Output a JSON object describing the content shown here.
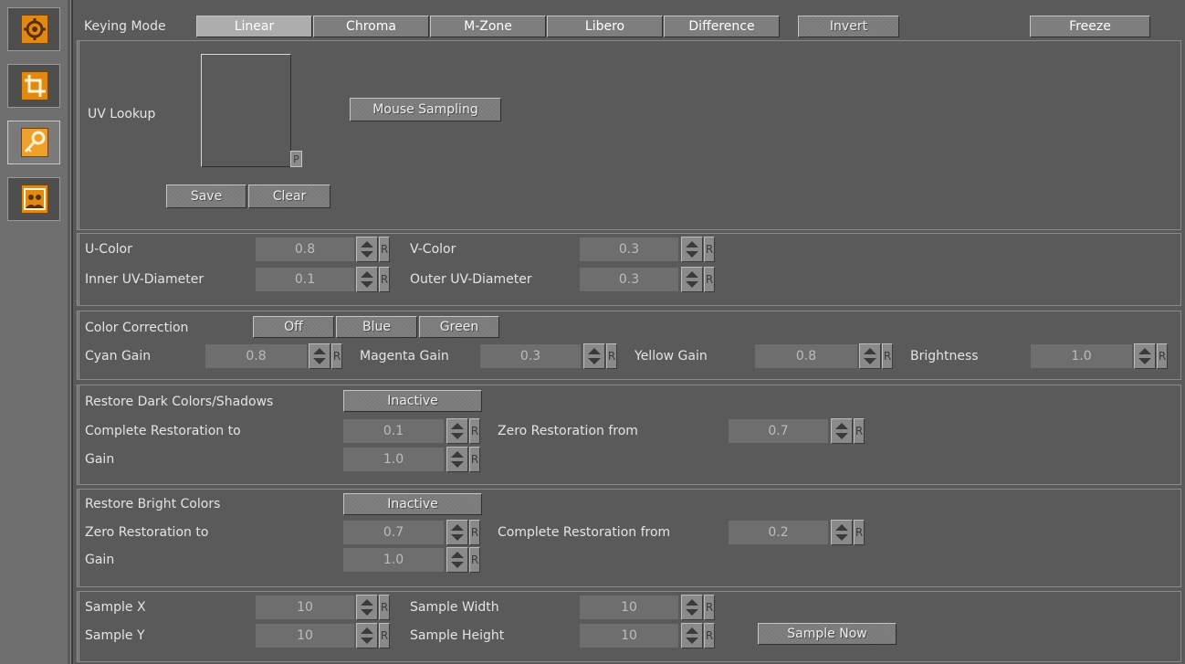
{
  "sidebar": {
    "icons": [
      {
        "name": "gear-icon"
      },
      {
        "name": "crop-icon"
      },
      {
        "name": "key-icon"
      },
      {
        "name": "user-group-icon"
      }
    ],
    "selected": "key-icon"
  },
  "keying": {
    "label": "Keying Mode",
    "modes": [
      "Linear",
      "Chroma",
      "M-Zone",
      "Libero",
      "Difference"
    ],
    "selected_mode": "Linear",
    "invert": "Invert",
    "freeze": "Freeze"
  },
  "uv_lookup": {
    "label": "UV Lookup",
    "mouse_sampling": "Mouse Sampling",
    "p_label": "P",
    "save": "Save",
    "clear": "Clear"
  },
  "uv": {
    "u_color": {
      "label": "U-Color",
      "value": "0.8"
    },
    "v_color": {
      "label": "V-Color",
      "value": "0.3"
    },
    "inner": {
      "label": "Inner UV-Diameter",
      "value": "0.1"
    },
    "outer": {
      "label": "Outer UV-Diameter",
      "value": "0.3"
    }
  },
  "color_correction": {
    "label": "Color Correction",
    "options": [
      "Off",
      "Blue",
      "Green"
    ],
    "selected": "Off",
    "cyan": {
      "label": "Cyan Gain",
      "value": "0.8"
    },
    "magenta": {
      "label": "Magenta Gain",
      "value": "0.3"
    },
    "yellow": {
      "label": "Yellow Gain",
      "value": "0.8"
    },
    "brightness": {
      "label": "Brightness",
      "value": "1.0"
    }
  },
  "restore_dark": {
    "label": "Restore Dark Colors/Shadows",
    "state": "Inactive",
    "complete_to": {
      "label": "Complete Restoration to",
      "value": "0.1"
    },
    "zero_from": {
      "label": "Zero Restoration from",
      "value": "0.7"
    },
    "gain": {
      "label": "Gain",
      "value": "1.0"
    }
  },
  "restore_bright": {
    "label": "Restore Bright Colors",
    "state": "Inactive",
    "zero_to": {
      "label": "Zero Restoration to",
      "value": "0.7"
    },
    "complete_from": {
      "label": "Complete Restoration from",
      "value": "0.2"
    },
    "gain": {
      "label": "Gain",
      "value": "1.0"
    }
  },
  "sample": {
    "x": {
      "label": "Sample X",
      "value": "10"
    },
    "y": {
      "label": "Sample Y",
      "value": "10"
    },
    "width": {
      "label": "Sample Width",
      "value": "10"
    },
    "height": {
      "label": "Sample Height",
      "value": "10"
    },
    "sample_now": "Sample Now"
  },
  "reset_label": "R",
  "colors": {
    "background": "#5a5a5a",
    "field": "#6e6e6e",
    "button": "#7e7e7e",
    "active_button": "#adadad",
    "icon_orange": "#e08a12"
  }
}
